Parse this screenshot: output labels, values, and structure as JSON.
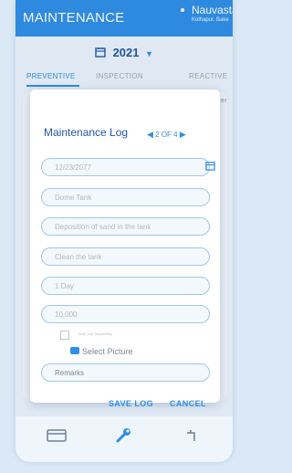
{
  "app": {
    "title": "MAINTENANCE",
    "location_name": "Nauvasta",
    "location_sub": "Kolhapur, Bake"
  },
  "filter": {
    "year": "2021"
  },
  "tabs": [
    {
      "label": "PREVENTIVE",
      "active": true
    },
    {
      "label": "INSPECTION",
      "active": false
    },
    {
      "label": "REACTIVE",
      "active": false
    }
  ],
  "list": {
    "sort_label": "SORT BY"
  },
  "modal": {
    "title": "Maintenance Log",
    "pager": "2 OF 4",
    "date": "12/23/2077",
    "asset": "Dome Tank",
    "description": "Deposition of sand in the tank",
    "action": "Clean the tank",
    "duration": "1 Day",
    "cost": "10,000",
    "checkbox_label": "Add Cost Separately",
    "select_picture": "Select Picture",
    "remarks_placeholder": "Remarks",
    "save_label": "SAVE LOG",
    "cancel_label": "CANCEL"
  },
  "colors": {
    "accent": "#2f8fe6",
    "title": "#2456a6",
    "badge": "#e8632f"
  },
  "icons": [
    "calendar-icon",
    "chevron-down-icon",
    "chevron-left-icon",
    "chevron-right-icon",
    "camera-icon",
    "wrench-icon",
    "card-icon",
    "tap-icon"
  ]
}
